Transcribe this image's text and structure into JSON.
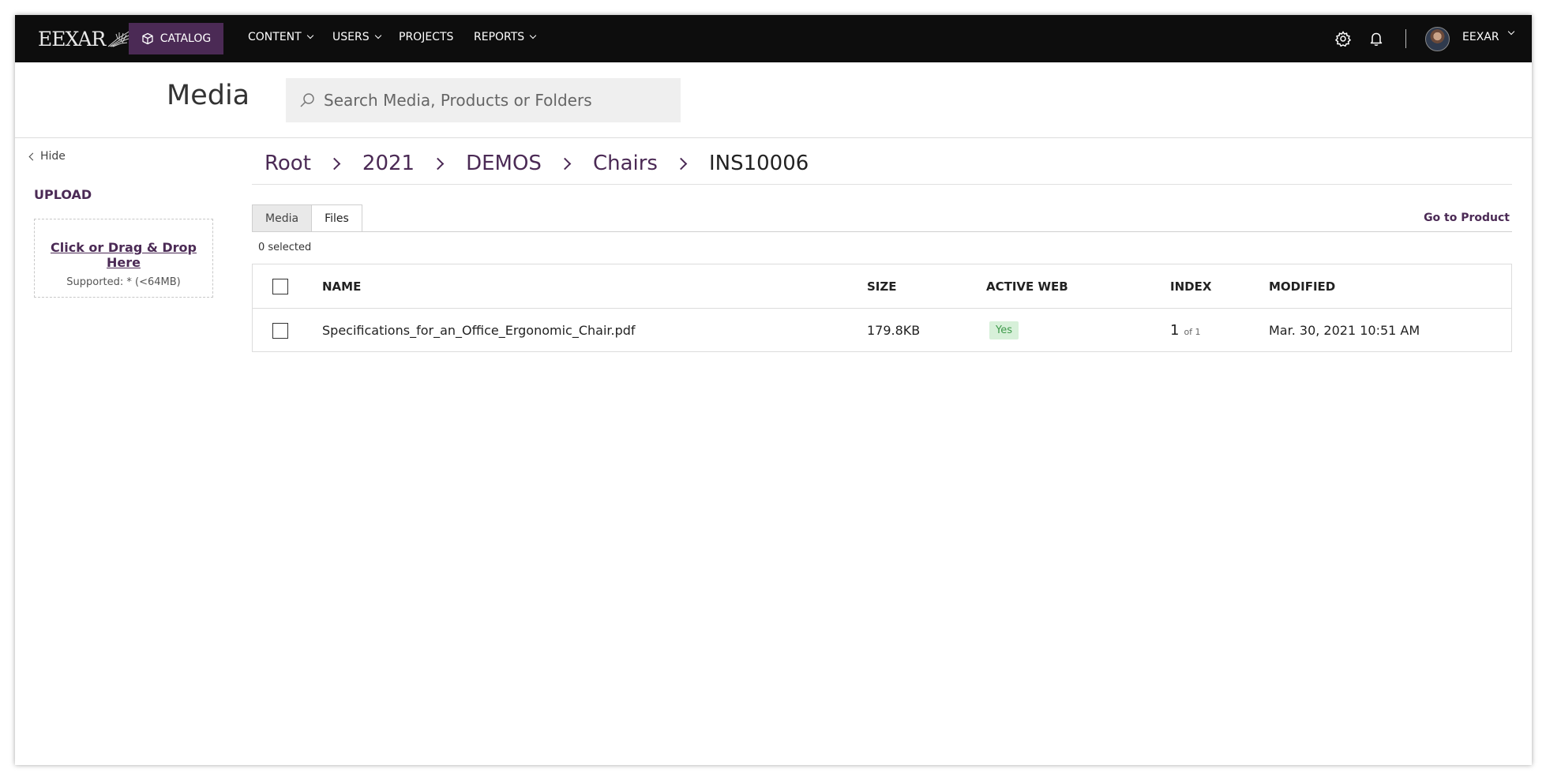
{
  "topbar": {
    "logo_text": "EEXAR",
    "catalog_label": "CATALOG",
    "nav": [
      {
        "label": "CONTENT"
      },
      {
        "label": "USERS"
      },
      {
        "label": "PROJECTS"
      },
      {
        "label": "REPORTS"
      }
    ],
    "user_name": "EEXAR"
  },
  "header": {
    "title": "Media",
    "search_placeholder": "Search Media, Products or Folders"
  },
  "sidebar": {
    "hide_label": "Hide",
    "upload_title": "UPLOAD",
    "dropzone_link": "Click or Drag & Drop Here",
    "dropzone_sub": "Supported: * (<64MB)"
  },
  "breadcrumb": [
    "Root",
    "2021",
    "DEMOS",
    "Chairs",
    "INS10006"
  ],
  "tabs": [
    {
      "label": "Media",
      "active": false
    },
    {
      "label": "Files",
      "active": true
    }
  ],
  "go_to_product": "Go to Product",
  "selected_count": "0 selected",
  "table": {
    "headers": {
      "name": "NAME",
      "size": "SIZE",
      "active_web": "ACTIVE WEB",
      "index": "INDEX",
      "modified": "MODIFIED"
    },
    "rows": [
      {
        "name": "Specifications_for_an_Office_Ergonomic_Chair.pdf",
        "size": "179.8KB",
        "active_web": "Yes",
        "index": "1",
        "index_total": "of 1",
        "modified": "Mar. 30, 2021 10:51 AM"
      }
    ]
  },
  "colors": {
    "brand": "#4b2a55",
    "topbar_bg": "#0d0d0d",
    "active_badge_bg": "#d7f0d9",
    "active_badge_text": "#3e9a4b"
  }
}
